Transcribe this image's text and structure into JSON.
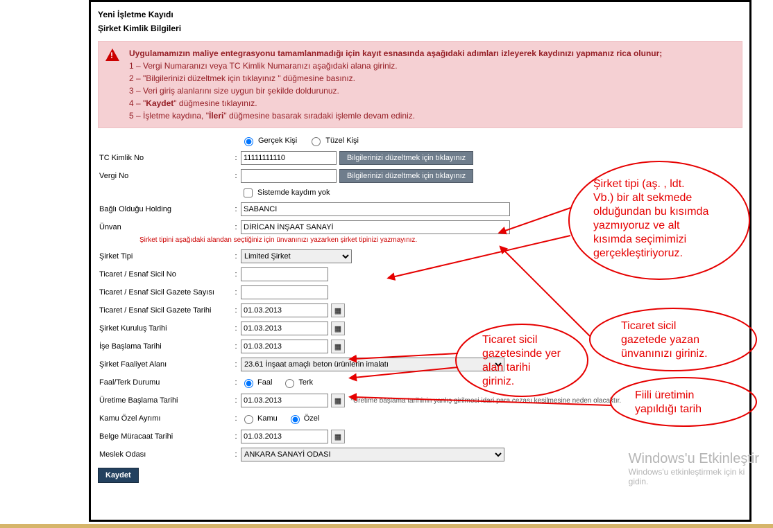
{
  "header": {
    "title1": "Yeni İşletme Kayıdı",
    "title2": "Şirket Kimlik Bilgileri"
  },
  "alert": {
    "lead": "Uygulamamızın maliye entegrasyonu tamamlanmadığı için kayıt esnasında aşağıdaki adımları izleyerek kaydınızı yapmanız rica olunur;",
    "s1": "1 – Vergi Numaranızı veya TC Kimlik Numaranızı aşağıdaki alana giriniz.",
    "s2": "2 – \"Bilgilerinizi düzeltmek için tıklayınız \" düğmesine basınız.",
    "s3": "3 – Veri giriş alanlarını size uygun bir şekilde doldurunuz.",
    "s4_pre": "4 – \"",
    "s4_bold": "Kaydet",
    "s4_post": "\" düğmesine tıklayınız.",
    "s5_pre": "5 – İşletme kaydına, \"",
    "s5_bold": "İleri",
    "s5_post": "\"  düğmesine basarak sıradaki işlemle devam ediniz."
  },
  "radios": {
    "gercek": "Gerçek Kişi",
    "tuzel": "Tüzel Kişi",
    "faal": "Faal",
    "terk": "Terk",
    "kamu": "Kamu",
    "ozel": "Özel"
  },
  "labels": {
    "tc": "TC Kimlik No",
    "vergi": "Vergi No",
    "sistemde": "Sistemde kaydım yok",
    "holding": "Bağlı Olduğu Holding",
    "unvan": "Ünvan",
    "hintRed": "Şirket tipini aşağıdaki alandan  seçtiğiniz için ünvanınızı yazarken şirket tipinizi yazmayınız.",
    "sirketTipi": "Şirket Tipi",
    "ticaretNo": "Ticaret / Esnaf Sicil No",
    "gazeteSayi": "Ticaret / Esnaf Sicil Gazete Sayısı",
    "gazeteTarih": "Ticaret / Esnaf Sicil Gazete Tarihi",
    "kurulus": "Şirket Kuruluş Tarihi",
    "iseBaslama": "İşe Başlama Tarihi",
    "faaliyet": "Şirket Faaliyet Alanı",
    "faalTerk": "Faal/Terk Durumu",
    "uretim": "Üretime Başlama Tarihi",
    "uretimNote": "*Üretime başlama tarihinin yanlış girilmesi idari para cezası kesilmesine neden olacaktır.",
    "kamuOzel": "Kamu Özel Ayrımı",
    "belge": "Belge Müracaat Tarihi",
    "meslek": "Meslek Odası"
  },
  "values": {
    "tc": "11111111110",
    "vergi": "",
    "holding": "SABANCI",
    "unvan": "DİRİCAN İNŞAAT SANAYİ",
    "sirketTipi": "Limited Şirket",
    "ticaretNo": "",
    "gazeteSayi": "",
    "gazeteTarih": "01.03.2013",
    "kurulus": "01.03.2013",
    "iseBaslama": "01.03.2013",
    "faaliyet": "23.61   İnşaat amaçlı beton ürünlerin imalatı",
    "uretim": "01.03.2013",
    "belge": "01.03.2013",
    "meslek": "ANKARA SANAYİ ODASI"
  },
  "buttons": {
    "fix": "Bilgilerinizi düzeltmek için tıklayınız",
    "save": "Kaydet"
  },
  "callouts": {
    "c1l1": "Şirket tipi (aş. , ldt.",
    "c1l2": "Vb.) bir alt sekmede",
    "c1l3": "olduğundan bu kısımda",
    "c1l4": "yazmıyoruz ve alt",
    "c1l5": "kısımda seçimimizi",
    "c1l6": "gerçekleştiriyoruz.",
    "c2l1": "Ticaret sicil",
    "c2l2": "gazetede yazan",
    "c2l3": "ünvanınızı giriniz.",
    "c3l1": "Ticaret sicil",
    "c3l2": "gazetesinde yer",
    "c3l3": "alan tarihi",
    "c3l4": "giriniz.",
    "c4l1": "Fiili üretimin",
    "c4l2": "yapıldığı tarih"
  },
  "watermark": {
    "l1": "Windows'u Etkinleştir",
    "l2": "Windows'u etkinleştirmek için ki",
    "l3": "gidin."
  }
}
